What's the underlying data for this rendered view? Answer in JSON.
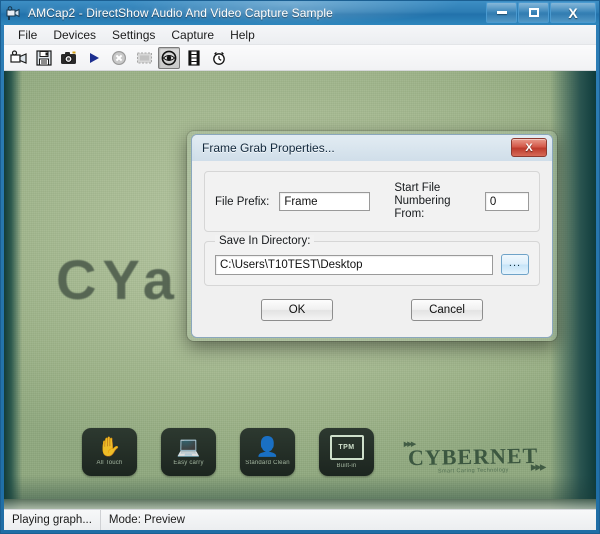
{
  "window": {
    "title": "AMCap2 - DirectShow Audio And Video Capture Sample",
    "app_icon": "camcorder-icon",
    "controls": {
      "minimize": "minimize-icon",
      "maximize": "maximize-icon",
      "close": "X"
    }
  },
  "menubar": {
    "items": [
      {
        "label": "File"
      },
      {
        "label": "Devices"
      },
      {
        "label": "Settings"
      },
      {
        "label": "Capture"
      },
      {
        "label": "Help"
      }
    ]
  },
  "toolbar": {
    "buttons": [
      {
        "name": "select-capture-device-icon",
        "pressed": false
      },
      {
        "name": "save-icon",
        "pressed": false
      },
      {
        "name": "snapshot-camera-icon",
        "pressed": false
      },
      {
        "name": "play-icon",
        "pressed": false
      },
      {
        "name": "stop-icon",
        "pressed": false
      },
      {
        "name": "record-icon",
        "pressed": false
      },
      {
        "name": "preview-eye-icon",
        "pressed": true
      },
      {
        "name": "filmstrip-icon",
        "pressed": false
      },
      {
        "name": "timer-icon",
        "pressed": false
      }
    ]
  },
  "video_preview": {
    "big_text": "CYa",
    "brand": {
      "name": "CYBERNET",
      "tagline": "Smart Caring Technology"
    },
    "feature_badges": [
      {
        "icon": "hand-touch-icon",
        "label": "All Touch"
      },
      {
        "icon": "easy-carry-icon",
        "label": "Easy carry"
      },
      {
        "icon": "person-support-icon",
        "label": "Standard Clean"
      },
      {
        "icon": "tpm-chip-icon",
        "label": "Built-in",
        "chip_text": "TPM"
      }
    ],
    "background_color": "#a9bc94"
  },
  "statusbar": {
    "panes": [
      {
        "text": "Playing graph..."
      },
      {
        "text": "Mode: Preview"
      }
    ]
  },
  "dialog": {
    "title": "Frame Grab Properties...",
    "close_label": "X",
    "close_color": "#c9422f",
    "fields": {
      "file_prefix_label": "File Prefix:",
      "file_prefix_value": "Frame",
      "start_numbering_label_line1": "Start File",
      "start_numbering_label_line2": "Numbering From:",
      "start_numbering_value": "0",
      "save_dir_legend": "Save In Directory:",
      "save_dir_value": "C:\\Users\\T10TEST\\Desktop",
      "browse_label": "..."
    },
    "buttons": {
      "ok": "OK",
      "cancel": "Cancel"
    }
  }
}
